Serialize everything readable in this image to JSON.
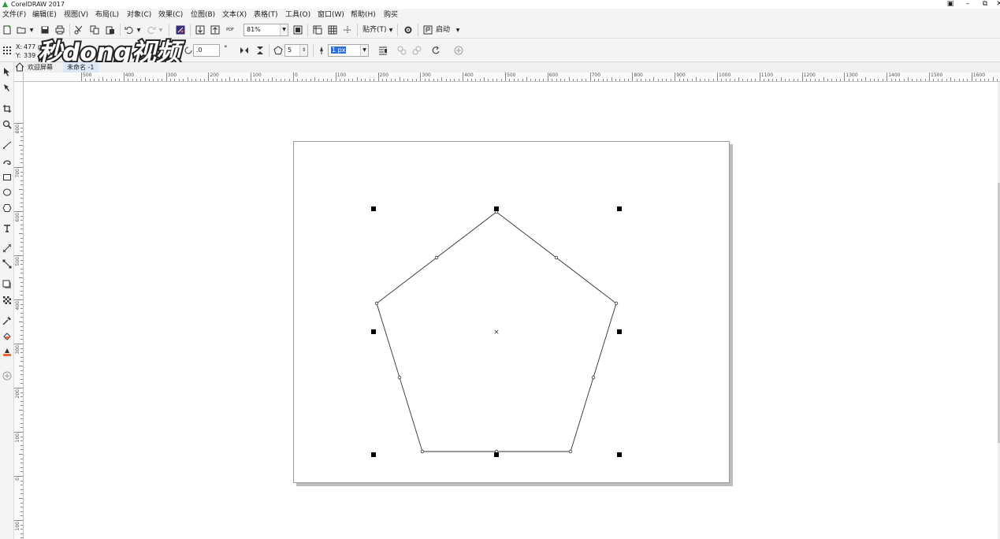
{
  "app": {
    "title": "CorelDRAW 2017",
    "accent_color": "#2f9a3a"
  },
  "window_controls": {
    "minimize": "–",
    "restore": "⧉",
    "close": "✕"
  },
  "menu": {
    "items": [
      "文件(F)",
      "编辑(E)",
      "视图(V)",
      "布局(L)",
      "对象(C)",
      "效果(C)",
      "位图(B)",
      "文本(X)",
      "表格(T)",
      "工具(O)",
      "窗口(W)",
      "帮助(H)",
      "购买"
    ]
  },
  "toolbar": {
    "zoom_value": "81%",
    "snap_label": "贴齐(T)",
    "launch_label": "启动",
    "pdf_label": "PDF"
  },
  "property_bar": {
    "x_label": "X:",
    "x_value": "477 p",
    "y_label": "Y:",
    "y_value": "339",
    "angle_value": ".0",
    "degree_symbol": "°",
    "sides_value": "5",
    "outline_width": "1 px"
  },
  "watermark": {
    "text": "秒dong视频"
  },
  "doc_tabs": [
    "欢迎屏幕",
    "未命名 -1"
  ],
  "ruler": {
    "h_labels": [
      "500",
      "400",
      "300",
      "200",
      "100",
      "0",
      "100",
      "200",
      "300",
      "400",
      "500",
      "600",
      "700",
      "800",
      "900",
      "1000",
      "1100",
      "1200",
      "1300",
      "1400",
      "1500",
      "1600"
    ],
    "v_labels": [
      "800",
      "700",
      "600",
      "500",
      "400",
      "300",
      "200",
      "100",
      "0",
      "100"
    ]
  },
  "shape": {
    "type": "polygon",
    "sides": 5,
    "stroke_color": "#333333",
    "center_marker": "×"
  },
  "tools": [
    "pick-tool-icon",
    "shape-tool-icon",
    "crop-tool-icon",
    "zoom-tool-icon",
    "freehand-tool-icon",
    "artistic-media-icon",
    "rectangle-tool-icon",
    "ellipse-tool-icon",
    "polygon-tool-icon",
    "text-tool-icon",
    "parallel-dimension-icon",
    "connector-tool-icon",
    "drop-shadow-icon",
    "transparency-icon",
    "eyedropper-icon",
    "interactive-fill-icon",
    "smart-fill-icon",
    "add-tool-icon"
  ]
}
